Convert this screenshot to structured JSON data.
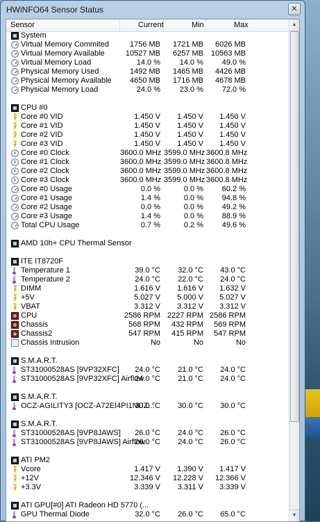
{
  "window": {
    "title": "HWiNFO64 Sensor Status",
    "close_label": "✕"
  },
  "columns": {
    "sensor": "Sensor",
    "current": "Current",
    "min": "Min",
    "max": "Max"
  },
  "rows": [
    {
      "kind": "group",
      "icon": "chip",
      "name": "System"
    },
    {
      "kind": "item",
      "icon": "gauge",
      "name": "Virtual Memory Commited",
      "cur": "1756 MB",
      "min": "1721 MB",
      "max": "6026 MB"
    },
    {
      "kind": "item",
      "icon": "gauge",
      "name": "Virtual Memory Available",
      "cur": "10527 MB",
      "min": "6257 MB",
      "max": "10563 MB"
    },
    {
      "kind": "item",
      "icon": "gauge",
      "name": "Virtual Memory Load",
      "cur": "14.0 %",
      "min": "14.0 %",
      "max": "49.0 %"
    },
    {
      "kind": "item",
      "icon": "gauge",
      "name": "Physical Memory Used",
      "cur": "1492 MB",
      "min": "1465 MB",
      "max": "4426 MB"
    },
    {
      "kind": "item",
      "icon": "gauge",
      "name": "Physical Memory Available",
      "cur": "4650 MB",
      "min": "1716 MB",
      "max": "4678 MB"
    },
    {
      "kind": "item",
      "icon": "gauge",
      "name": "Physical Memory Load",
      "cur": "24.0 %",
      "min": "23.0 %",
      "max": "72.0 %"
    },
    {
      "kind": "blank"
    },
    {
      "kind": "group",
      "icon": "chip",
      "name": "CPU #0"
    },
    {
      "kind": "item",
      "icon": "bolt",
      "name": "Core #0 VID",
      "cur": "1.450 V",
      "min": "1.450 V",
      "max": "1.450 V"
    },
    {
      "kind": "item",
      "icon": "bolt",
      "name": "Core #1 VID",
      "cur": "1.450 V",
      "min": "1.450 V",
      "max": "1.450 V"
    },
    {
      "kind": "item",
      "icon": "bolt",
      "name": "Core #2 VID",
      "cur": "1.450 V",
      "min": "1.450 V",
      "max": "1.450 V"
    },
    {
      "kind": "item",
      "icon": "bolt",
      "name": "Core #3 VID",
      "cur": "1.450 V",
      "min": "1.450 V",
      "max": "1.450 V"
    },
    {
      "kind": "item",
      "icon": "clock",
      "name": "Core #0 Clock",
      "cur": "3600.0 MHz",
      "min": "3599.0 MHz",
      "max": "3600.8 MHz"
    },
    {
      "kind": "item",
      "icon": "clock",
      "name": "Core #1 Clock",
      "cur": "3600.0 MHz",
      "min": "3599.0 MHz",
      "max": "3600.8 MHz"
    },
    {
      "kind": "item",
      "icon": "clock",
      "name": "Core #2 Clock",
      "cur": "3600.0 MHz",
      "min": "3599.0 MHz",
      "max": "3600.8 MHz"
    },
    {
      "kind": "item",
      "icon": "clock",
      "name": "Core #3 Clock",
      "cur": "3600.0 MHz",
      "min": "3599.0 MHz",
      "max": "3600.8 MHz"
    },
    {
      "kind": "item",
      "icon": "gauge",
      "name": "Core #0 Usage",
      "cur": "0.0 %",
      "min": "0.0 %",
      "max": "60.2 %"
    },
    {
      "kind": "item",
      "icon": "gauge",
      "name": "Core #1 Usage",
      "cur": "1.4 %",
      "min": "0.0 %",
      "max": "94.8 %"
    },
    {
      "kind": "item",
      "icon": "gauge",
      "name": "Core #2 Usage",
      "cur": "0.0 %",
      "min": "0.0 %",
      "max": "49.2 %"
    },
    {
      "kind": "item",
      "icon": "gauge",
      "name": "Core #3 Usage",
      "cur": "1.4 %",
      "min": "0.0 %",
      "max": "88.9 %"
    },
    {
      "kind": "item",
      "icon": "gauge",
      "name": "Total CPU Usage",
      "cur": "0.7 %",
      "min": "0.2 %",
      "max": "49.6 %"
    },
    {
      "kind": "blank"
    },
    {
      "kind": "group",
      "icon": "chip",
      "name": "AMD 10h+ CPU Thermal Sensor"
    },
    {
      "kind": "blank"
    },
    {
      "kind": "group",
      "icon": "chip",
      "name": "ITE IT8720F"
    },
    {
      "kind": "item",
      "icon": "therm",
      "name": "Temperature 1",
      "cur": "39.0 °C",
      "min": "32.0 °C",
      "max": "43.0 °C"
    },
    {
      "kind": "item",
      "icon": "therm",
      "name": "Temperature 2",
      "cur": "24.0 °C",
      "min": "22.0 °C",
      "max": "24.0 °C"
    },
    {
      "kind": "item",
      "icon": "bolt",
      "name": "DIMM",
      "cur": "1.616 V",
      "min": "1.616 V",
      "max": "1.632 V"
    },
    {
      "kind": "item",
      "icon": "bolt",
      "name": "+5V",
      "cur": "5.027 V",
      "min": "5.000 V",
      "max": "5.027 V"
    },
    {
      "kind": "item",
      "icon": "bolt",
      "name": "VBAT",
      "cur": "3.312 V",
      "min": "3.312 V",
      "max": "3.312 V"
    },
    {
      "kind": "item",
      "icon": "fan",
      "name": "CPU",
      "cur": "2586 RPM",
      "min": "2227 RPM",
      "max": "2586 RPM"
    },
    {
      "kind": "item",
      "icon": "fan",
      "name": "Chassis",
      "cur": "568 RPM",
      "min": "432 RPM",
      "max": "569 RPM"
    },
    {
      "kind": "item",
      "icon": "fan",
      "name": "Chassis2",
      "cur": "547 RPM",
      "min": "415 RPM",
      "max": "547 RPM"
    },
    {
      "kind": "item",
      "icon": "box",
      "name": "Chassis Intrusion",
      "cur": "No",
      "min": "No",
      "max": "No"
    },
    {
      "kind": "blank"
    },
    {
      "kind": "group",
      "icon": "chip",
      "name": "S.M.A.R.T."
    },
    {
      "kind": "item",
      "icon": "therm",
      "name": "ST31000528AS [9VP32XFC]",
      "cur": "24.0 °C",
      "min": "21.0 °C",
      "max": "24.0 °C"
    },
    {
      "kind": "item",
      "icon": "therm",
      "name": "ST31000528AS [9VP32XFC] Airflow",
      "cur": "24.0 °C",
      "min": "21.0 °C",
      "max": "24.0 °C"
    },
    {
      "kind": "blank"
    },
    {
      "kind": "group",
      "icon": "chip",
      "name": "S.M.A.R.T."
    },
    {
      "kind": "item",
      "icon": "therm",
      "name": "OCZ-AGILITY3 [OCZ-A72EI4PI1NUZ...",
      "cur": "30.0 °C",
      "min": "30.0 °C",
      "max": "30.0 °C"
    },
    {
      "kind": "blank"
    },
    {
      "kind": "group",
      "icon": "chip",
      "name": "S.M.A.R.T."
    },
    {
      "kind": "item",
      "icon": "therm",
      "name": "ST31000528AS [9VP8JAWS]",
      "cur": "26.0 °C",
      "min": "24.0 °C",
      "max": "26.0 °C"
    },
    {
      "kind": "item",
      "icon": "therm",
      "name": "ST31000528AS [9VP8JAWS] Airflow",
      "cur": "26.0 °C",
      "min": "24.0 °C",
      "max": "26.0 °C"
    },
    {
      "kind": "blank"
    },
    {
      "kind": "group",
      "icon": "chip",
      "name": "ATI PM2"
    },
    {
      "kind": "item",
      "icon": "bolt",
      "name": "Vcore",
      "cur": "1.417 V",
      "min": "1.390 V",
      "max": "1.417 V"
    },
    {
      "kind": "item",
      "icon": "bolt",
      "name": "+12V",
      "cur": "12.346 V",
      "min": "12.228 V",
      "max": "12.366 V"
    },
    {
      "kind": "item",
      "icon": "bolt",
      "name": "+3.3V",
      "cur": "3.339 V",
      "min": "3.311 V",
      "max": "3.339 V"
    },
    {
      "kind": "blank"
    },
    {
      "kind": "group",
      "icon": "chip",
      "name": "ATI GPU[#0] ATI Radeon HD 5770 (..."
    },
    {
      "kind": "item",
      "icon": "therm",
      "name": "GPU Thermal Diode",
      "cur": "32.0 °C",
      "min": "26.0 °C",
      "max": "65.0 °C"
    }
  ]
}
